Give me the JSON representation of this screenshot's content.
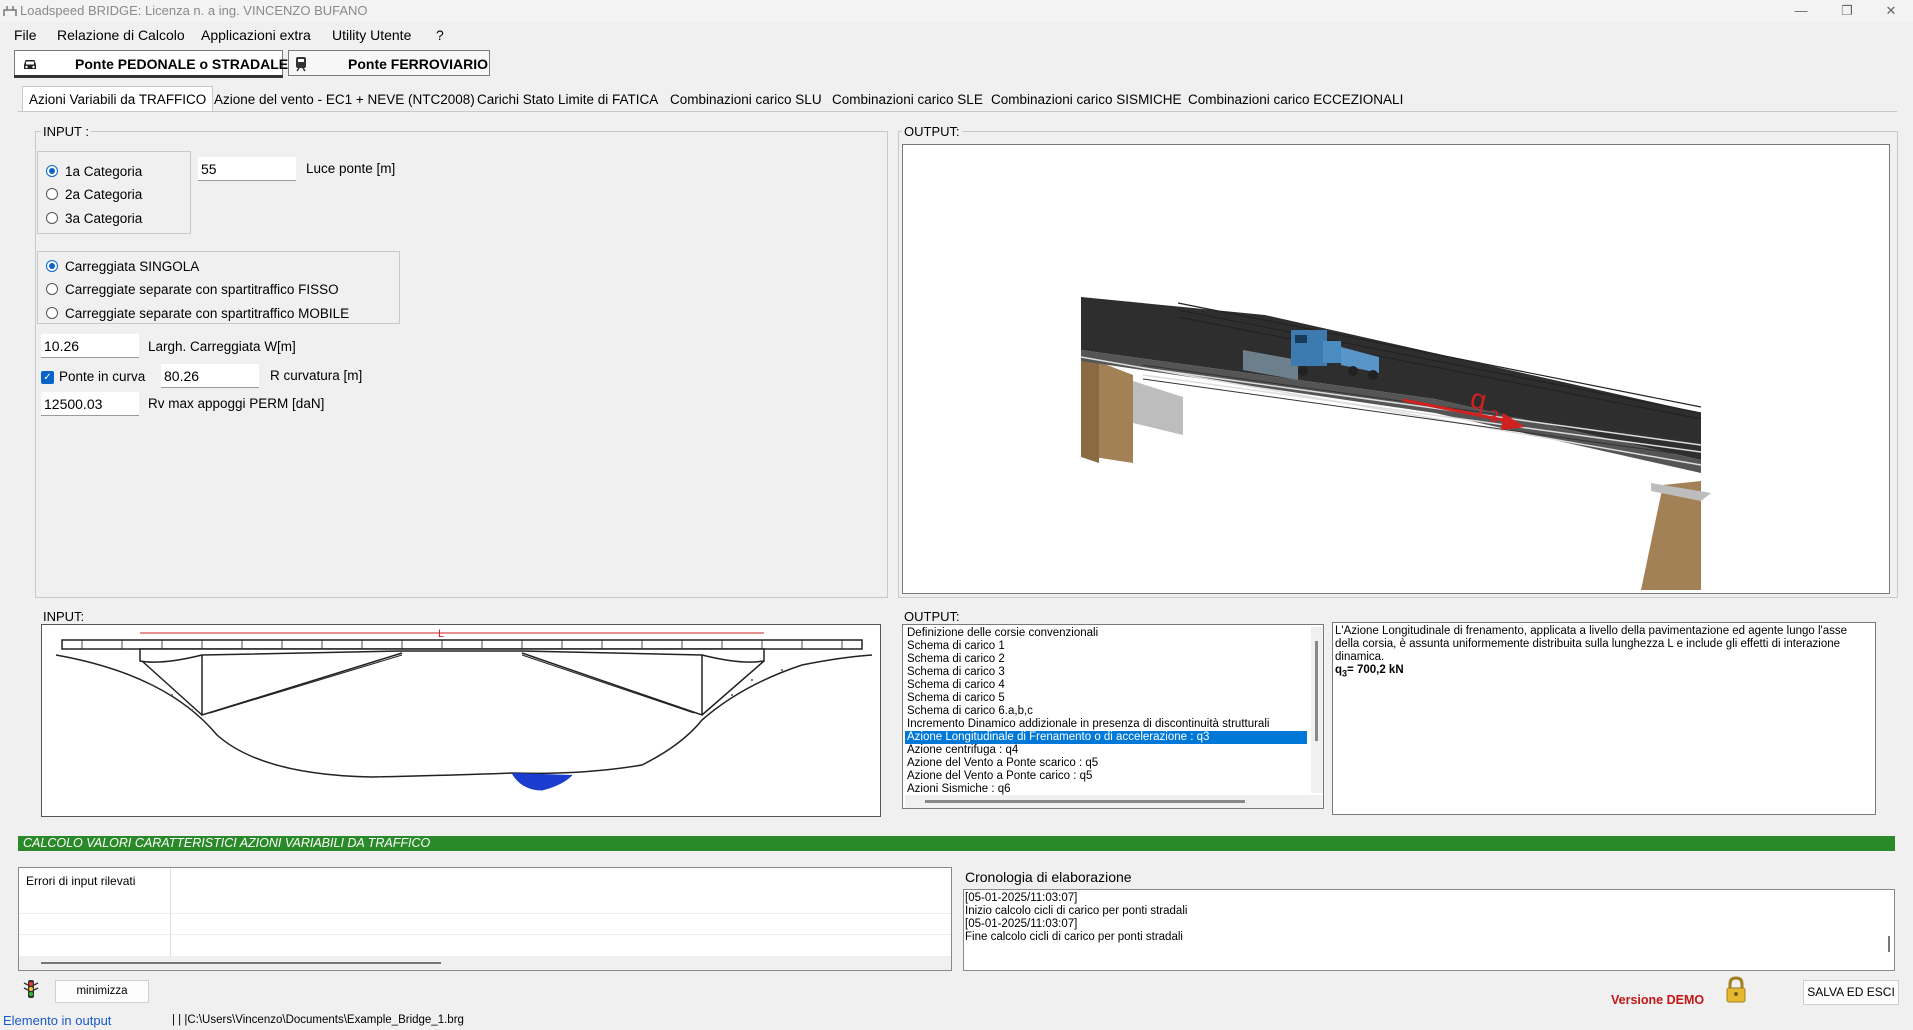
{
  "window": {
    "title": "Loadspeed BRIDGE: Licenza n.  a ing. VINCENZO BUFANO",
    "minimize": "—",
    "restore": "❐",
    "close": "✕"
  },
  "menu": [
    "File",
    "Relazione di Calcolo",
    "Applicazioni extra",
    "Utility Utente",
    "?"
  ],
  "mode_buttons": {
    "road": "Ponte PEDONALE o STRADALE",
    "rail": "Ponte FERROVIARIO"
  },
  "tabs": [
    "Azioni Variabili da TRAFFICO",
    "Azione del vento - EC1 + NEVE (NTC2008)",
    "Carichi Stato Limite di FATICA",
    "Combinazioni carico SLU",
    "Combinazioni carico SLE",
    "Combinazioni carico SISMICHE",
    "Combinazioni carico ECCEZIONALI"
  ],
  "input_panel": {
    "label": "INPUT :",
    "categories": [
      "1a Categoria",
      "2a Categoria",
      "3a Categoria"
    ],
    "selected_category": 0,
    "carriageways": [
      "Carreggiata SINGOLA",
      "Carreggiate separate con spartitraffico FISSO",
      "Carreggiate separate con spartitraffico MOBILE"
    ],
    "selected_carriageway": 0,
    "luce_value": "55",
    "luce_label": "Luce ponte [m]",
    "width_value": "10.26",
    "width_label": "Largh. Carreggiata W[m]",
    "curve_label": "Ponte in curva",
    "curve_checked": true,
    "radius_value": "80.26",
    "radius_label": "R curvatura [m]",
    "rv_value": "12500.03",
    "rv_label": "Rv max appoggi PERM [daN]"
  },
  "output_panel": {
    "label": "OUTPUT:",
    "annotation": "q",
    "annotation_sub": "3"
  },
  "input_drawing": {
    "label": "INPUT:",
    "span_label": "L"
  },
  "output_list": {
    "label": "OUTPUT:",
    "items": [
      "Definizione delle corsie convenzionali",
      "Schema di carico 1",
      "Schema di carico 2",
      "Schema di carico 3",
      "Schema di carico 4",
      "Schema di carico 5",
      "Schema di carico 6.a,b,c",
      "Incremento Dinamico addizionale in presenza di discontinuità strutturali",
      "Azione Longitudinale di Frenamento o di accelerazione : q3",
      "Azione centrifuga : q4",
      "Azione del Vento a Ponte scarico : q5",
      "Azione del Vento a Ponte carico  : q5",
      "Azioni Sismiche : q6"
    ],
    "selected_index": 8
  },
  "description": {
    "text": "L'Azione Longitudinale di frenamento, applicata a livello della pavimentazione ed agente lungo l'asse della corsia, è assunta uniformemente distribuita sulla lunghezza L e include gli effetti di interazione dinamica.",
    "result_symbol": "q",
    "result_sub": "3",
    "result_value": "= 700,2 kN"
  },
  "status_bar": {
    "text": "CALCOLO VALORI CARATTERISTICI AZIONI VARIABILI DA TRAFFICO",
    "color": "#2a8a2a"
  },
  "errors": {
    "label": "Errori di input rilevati"
  },
  "log": {
    "label": "Cronologia di elaborazione",
    "lines": [
      "[05-01-2025/11:03:07]",
      "Inizio calcolo cicli di carico per ponti stradali",
      "[05-01-2025/11:03:07]",
      "Fine calcolo cicli di carico per ponti stradali"
    ]
  },
  "bottom": {
    "minimize": "minimizza",
    "demo": "Versione DEMO",
    "save_exit": "SALVA ED ESCI",
    "output_element": "Elemento in output",
    "file_path": "| | |C:\\Users\\Vincenzo\\Documents\\Example_Bridge_1.brg"
  },
  "icons": {
    "app": "bridge-app-icon",
    "car": "car-icon",
    "train": "train-icon",
    "traffic_light": "traffic-light-icon",
    "lock": "lock-icon"
  }
}
